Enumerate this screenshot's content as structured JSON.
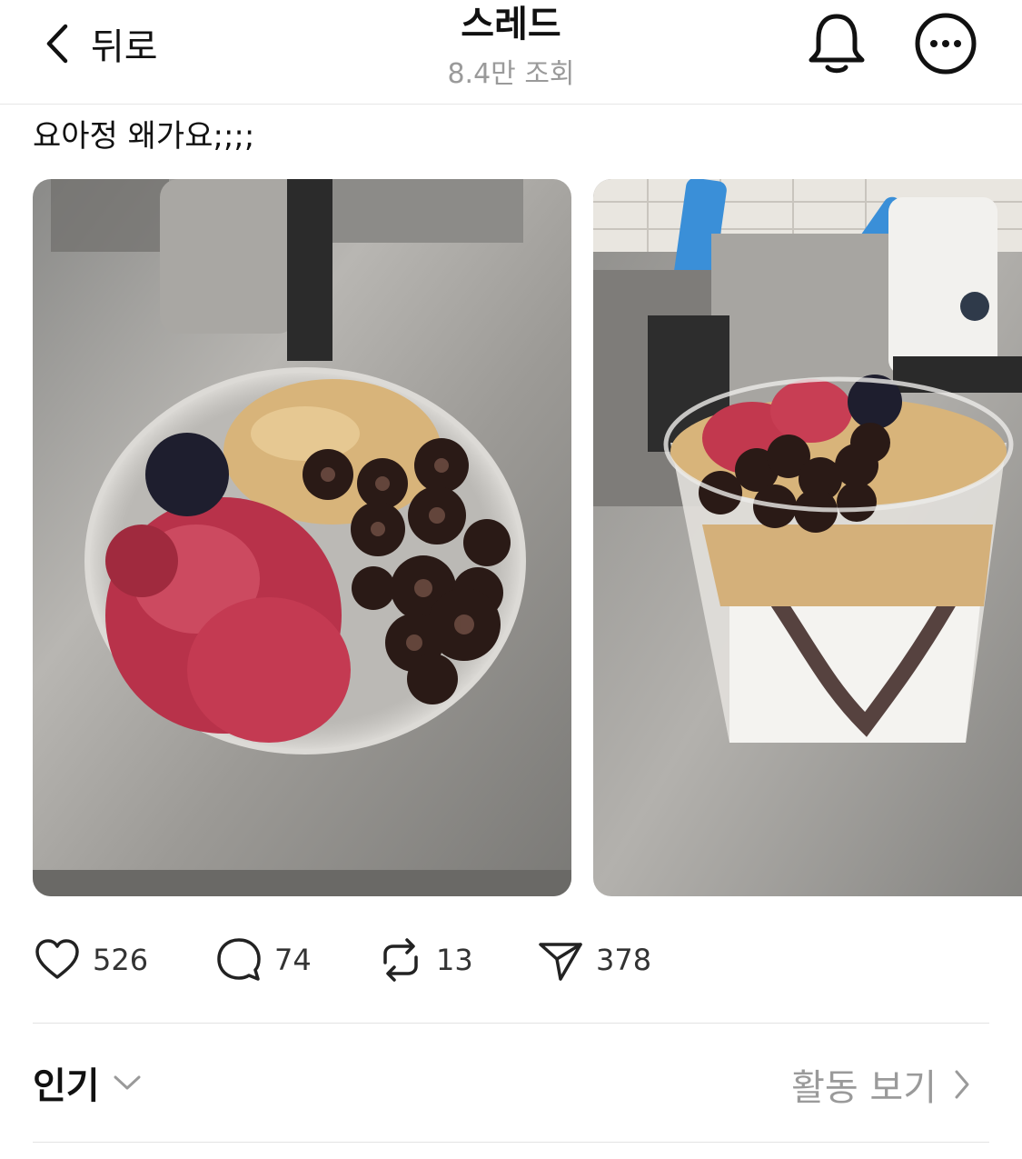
{
  "header": {
    "back_label": "뒤로",
    "title": "스레드",
    "subtitle": "8.4만 조회",
    "icons": [
      "chevron-left-icon",
      "bell-icon",
      "more-icon"
    ]
  },
  "post": {
    "text": "요아정 왜가요;;;;",
    "images": [
      "yogurt-bowl-top-view",
      "yogurt-cup-side-view"
    ]
  },
  "actions": {
    "likes": "526",
    "comments": "74",
    "reposts": "13",
    "shares": "378"
  },
  "sort": {
    "label": "인기",
    "activity_label": "활동 보기"
  }
}
